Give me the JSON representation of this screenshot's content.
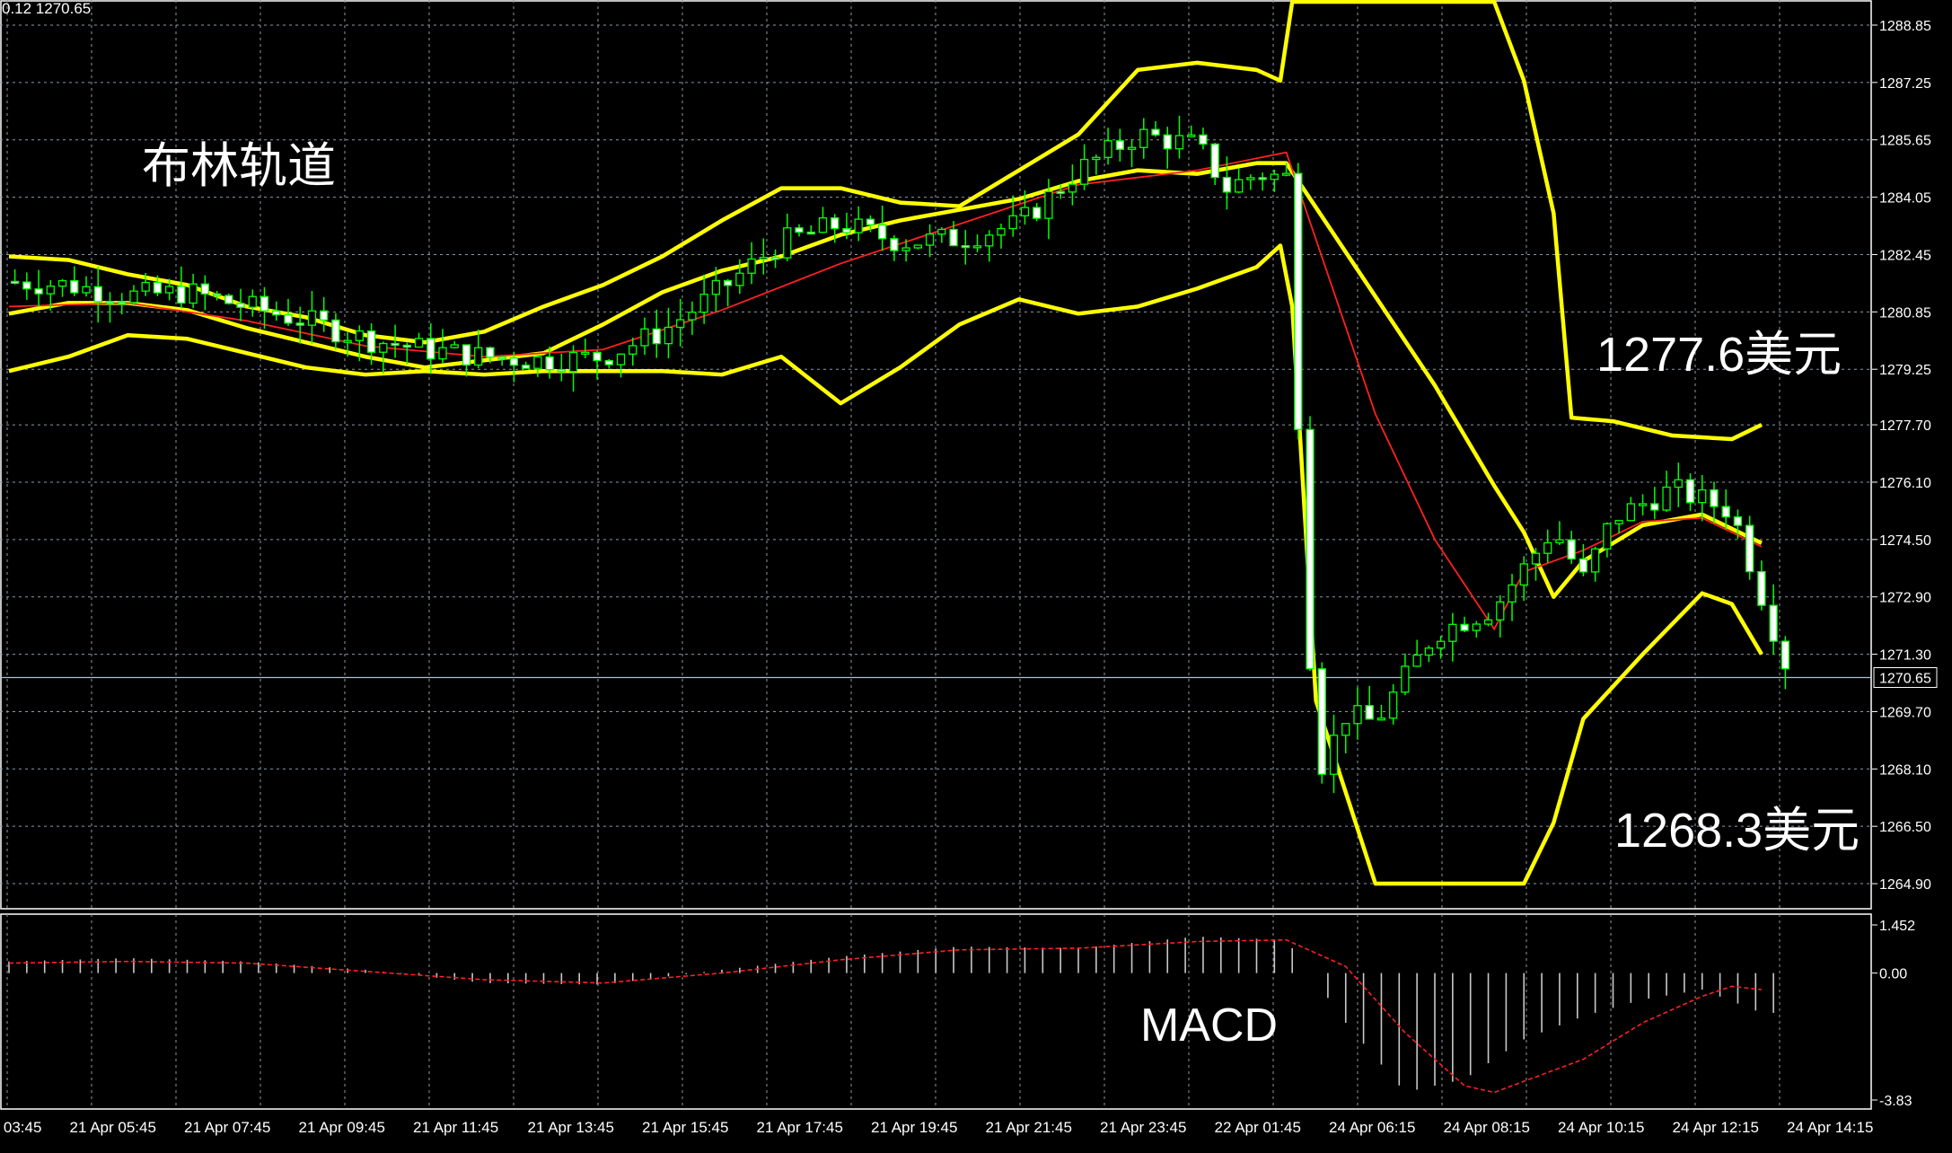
{
  "header": {
    "readout": "0.12 1270.65"
  },
  "annotations": {
    "title": "布林轨道",
    "upper_band_label": "1277.6美元",
    "lower_band_label": "1268.3美元",
    "macd_label": "MACD"
  },
  "colors": {
    "background": "#000000",
    "grid": "#8a9aa8",
    "bullish": "#00ff00",
    "bearish": "#ffffff",
    "bollinger": "#ffff00",
    "ema": "#ff2020",
    "macd_hist": "#c8c8c8",
    "macd_signal": "#ff2020",
    "axis_text": "#ffffff"
  },
  "chart_data": [
    {
      "type": "candlestick",
      "title": "",
      "indicator": "Bollinger Bands",
      "current_price": "1270.65",
      "ylim": [
        1264.2,
        1289.3
      ],
      "y_ticks": [
        "1288.85",
        "1287.25",
        "1285.65",
        "1284.05",
        "1282.45",
        "1280.85",
        "1279.25",
        "1277.70",
        "1276.10",
        "1274.50",
        "1272.90",
        "1271.30",
        "1269.70",
        "1268.10",
        "1266.50",
        "1264.90"
      ],
      "x_labels": [
        "21 Apr 03:45",
        "21 Apr 05:45",
        "21 Apr 07:45",
        "21 Apr 09:45",
        "21 Apr 11:45",
        "21 Apr 13:45",
        "21 Apr 15:45",
        "21 Apr 17:45",
        "21 Apr 19:45",
        "21 Apr 21:45",
        "21 Apr 23:45",
        "22 Apr 01:45",
        "24 Apr 06:15",
        "24 Apr 08:15",
        "24 Apr 10:15",
        "24 Apr 12:15",
        "24 Apr 14:15"
      ],
      "price_path": [
        [
          0,
          1281.7
        ],
        [
          10,
          1281.6
        ],
        [
          20,
          1281.3
        ],
        [
          30,
          1281.4
        ],
        [
          40,
          1281.0
        ],
        [
          50,
          1280.6
        ],
        [
          60,
          1280.1
        ],
        [
          70,
          1279.8
        ],
        [
          80,
          1279.6
        ],
        [
          90,
          1279.5
        ],
        [
          100,
          1279.6
        ],
        [
          110,
          1280.3
        ],
        [
          120,
          1281.5
        ],
        [
          130,
          1282.8
        ],
        [
          140,
          1283.3
        ],
        [
          150,
          1282.8
        ],
        [
          160,
          1282.9
        ],
        [
          170,
          1283.3
        ],
        [
          180,
          1284.8
        ],
        [
          190,
          1285.8
        ],
        [
          200,
          1285.5
        ],
        [
          205,
          1284.3
        ],
        [
          210,
          1284.7
        ],
        [
          215,
          1284.6
        ],
        [
          220,
          1267.9
        ],
        [
          225,
          1269.6
        ],
        [
          230,
          1269.4
        ],
        [
          240,
          1271.9
        ],
        [
          250,
          1272.6
        ],
        [
          260,
          1274.8
        ],
        [
          265,
          1273.4
        ],
        [
          270,
          1275.1
        ],
        [
          280,
          1275.9
        ],
        [
          290,
          1275.3
        ],
        [
          300,
          1270.6
        ]
      ],
      "bollinger": {
        "upper": [
          [
            0,
            1282.4
          ],
          [
            10,
            1282.3
          ],
          [
            20,
            1281.9
          ],
          [
            30,
            1281.6
          ],
          [
            40,
            1281.0
          ],
          [
            50,
            1280.7
          ],
          [
            60,
            1280.2
          ],
          [
            70,
            1280.0
          ],
          [
            80,
            1280.3
          ],
          [
            90,
            1281.0
          ],
          [
            100,
            1281.6
          ],
          [
            110,
            1282.4
          ],
          [
            120,
            1283.4
          ],
          [
            130,
            1284.3
          ],
          [
            140,
            1284.3
          ],
          [
            150,
            1283.9
          ],
          [
            160,
            1283.8
          ],
          [
            170,
            1284.8
          ],
          [
            180,
            1285.8
          ],
          [
            190,
            1287.6
          ],
          [
            200,
            1287.8
          ],
          [
            210,
            1287.6
          ],
          [
            214,
            1287.3
          ],
          [
            216,
            1289.5
          ],
          [
            250,
            1289.5
          ],
          [
            255,
            1287.3
          ],
          [
            260,
            1283.6
          ],
          [
            263,
            1277.9
          ],
          [
            270,
            1277.8
          ],
          [
            280,
            1277.4
          ],
          [
            290,
            1277.3
          ],
          [
            295,
            1277.7
          ]
        ],
        "middle": [
          [
            0,
            1280.8
          ],
          [
            10,
            1281.1
          ],
          [
            20,
            1281.1
          ],
          [
            30,
            1280.9
          ],
          [
            40,
            1280.4
          ],
          [
            50,
            1280.0
          ],
          [
            60,
            1279.6
          ],
          [
            70,
            1279.3
          ],
          [
            80,
            1279.5
          ],
          [
            90,
            1279.7
          ],
          [
            100,
            1280.5
          ],
          [
            110,
            1281.4
          ],
          [
            120,
            1282.0
          ],
          [
            130,
            1282.4
          ],
          [
            140,
            1283.0
          ],
          [
            150,
            1283.4
          ],
          [
            160,
            1283.7
          ],
          [
            170,
            1284.0
          ],
          [
            180,
            1284.5
          ],
          [
            190,
            1284.8
          ],
          [
            200,
            1284.7
          ],
          [
            210,
            1285.0
          ],
          [
            215,
            1285.0
          ],
          [
            240,
            1278.8
          ],
          [
            250,
            1276.0
          ],
          [
            255,
            1274.7
          ],
          [
            260,
            1272.9
          ],
          [
            265,
            1273.9
          ],
          [
            275,
            1274.9
          ],
          [
            285,
            1275.2
          ],
          [
            295,
            1274.4
          ]
        ],
        "lower": [
          [
            0,
            1279.2
          ],
          [
            10,
            1279.6
          ],
          [
            20,
            1280.2
          ],
          [
            30,
            1280.1
          ],
          [
            40,
            1279.7
          ],
          [
            50,
            1279.3
          ],
          [
            60,
            1279.1
          ],
          [
            70,
            1279.2
          ],
          [
            80,
            1279.1
          ],
          [
            90,
            1279.2
          ],
          [
            100,
            1279.2
          ],
          [
            110,
            1279.2
          ],
          [
            120,
            1279.1
          ],
          [
            130,
            1279.6
          ],
          [
            140,
            1278.3
          ],
          [
            150,
            1279.3
          ],
          [
            160,
            1280.5
          ],
          [
            170,
            1281.2
          ],
          [
            180,
            1280.8
          ],
          [
            190,
            1281.0
          ],
          [
            200,
            1281.5
          ],
          [
            210,
            1282.1
          ],
          [
            214,
            1282.7
          ],
          [
            216,
            1281.0
          ],
          [
            220,
            1270.0
          ],
          [
            230,
            1264.9
          ],
          [
            255,
            1264.9
          ],
          [
            260,
            1266.6
          ],
          [
            265,
            1269.5
          ],
          [
            275,
            1271.3
          ],
          [
            285,
            1273.0
          ],
          [
            290,
            1272.7
          ],
          [
            295,
            1271.3
          ]
        ]
      },
      "ema": [
        [
          0,
          1281.0
        ],
        [
          20,
          1281.1
        ],
        [
          40,
          1280.6
        ],
        [
          60,
          1279.9
        ],
        [
          80,
          1279.6
        ],
        [
          100,
          1279.8
        ],
        [
          120,
          1280.9
        ],
        [
          140,
          1282.2
        ],
        [
          160,
          1283.3
        ],
        [
          180,
          1284.4
        ],
        [
          200,
          1284.8
        ],
        [
          215,
          1285.3
        ],
        [
          230,
          1278.0
        ],
        [
          240,
          1274.5
        ],
        [
          250,
          1272.0
        ],
        [
          255,
          1273.6
        ],
        [
          265,
          1274.2
        ],
        [
          275,
          1275.0
        ],
        [
          285,
          1275.1
        ],
        [
          295,
          1274.3
        ]
      ]
    },
    {
      "type": "bar",
      "title": "MACD",
      "ylim": [
        -3.83,
        1.452
      ],
      "y_ticks": [
        "1.452",
        "0.00",
        "-3.83"
      ],
      "histogram": [
        [
          0,
          0.35
        ],
        [
          20,
          0.45
        ],
        [
          40,
          0.35
        ],
        [
          60,
          0.1
        ],
        [
          80,
          -0.3
        ],
        [
          100,
          -0.35
        ],
        [
          120,
          0.1
        ],
        [
          140,
          0.5
        ],
        [
          160,
          0.8
        ],
        [
          180,
          0.75
        ],
        [
          200,
          1.1
        ],
        [
          215,
          1.0
        ],
        [
          225,
          -1.5
        ],
        [
          235,
          -3.6
        ],
        [
          245,
          -3.2
        ],
        [
          255,
          -2.0
        ],
        [
          265,
          -1.3
        ],
        [
          275,
          -0.8
        ],
        [
          285,
          -0.5
        ],
        [
          295,
          -1.2
        ]
      ],
      "signal": [
        [
          0,
          0.3
        ],
        [
          20,
          0.35
        ],
        [
          40,
          0.3
        ],
        [
          60,
          0.05
        ],
        [
          80,
          -0.2
        ],
        [
          100,
          -0.3
        ],
        [
          120,
          0.0
        ],
        [
          140,
          0.4
        ],
        [
          160,
          0.7
        ],
        [
          180,
          0.75
        ],
        [
          200,
          0.95
        ],
        [
          215,
          1.0
        ],
        [
          225,
          0.2
        ],
        [
          235,
          -1.8
        ],
        [
          245,
          -3.4
        ],
        [
          250,
          -3.6
        ],
        [
          265,
          -2.6
        ],
        [
          275,
          -1.5
        ],
        [
          285,
          -0.7
        ],
        [
          290,
          -0.4
        ],
        [
          295,
          -0.5
        ]
      ]
    }
  ]
}
